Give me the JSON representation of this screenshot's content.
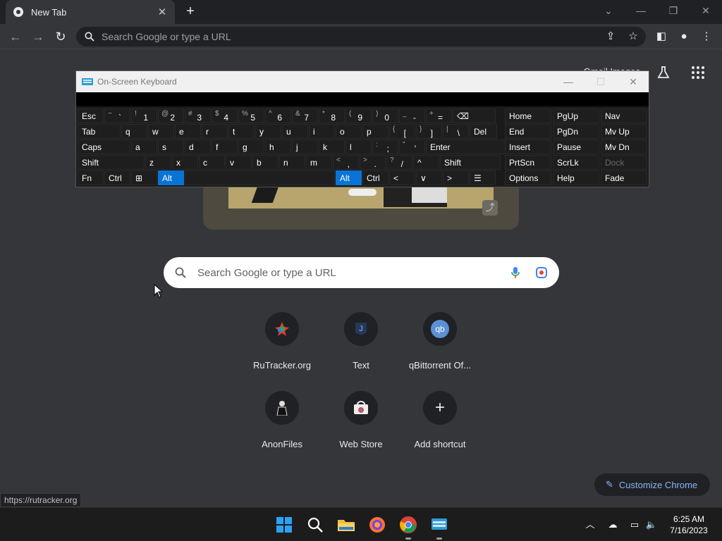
{
  "tab": {
    "title": "New Tab"
  },
  "omnibox": {
    "placeholder": "Search Google or type a URL"
  },
  "ntp": {
    "top_links": "Gmail   Images",
    "search_placeholder": "Search Google or type a URL",
    "shortcuts": [
      {
        "label": "RuTracker.org",
        "icon": "rutracker-icon"
      },
      {
        "label": "Text",
        "icon": "text-app-icon"
      },
      {
        "label": "qBittorrent Of...",
        "icon": "qbittorrent-icon"
      },
      {
        "label": "AnonFiles",
        "icon": "anonfiles-icon"
      },
      {
        "label": "Web Store",
        "icon": "web-store-icon"
      },
      {
        "label": "Add shortcut",
        "icon": "plus-icon"
      }
    ],
    "customize_label": "Customize Chrome"
  },
  "status_url": "https://rutracker.org",
  "osk": {
    "title": "On-Screen Keyboard",
    "rows": [
      [
        {
          "l": "Esc"
        },
        {
          "s": "~",
          "m": "`"
        },
        {
          "s": "!",
          "m": "1"
        },
        {
          "s": "@",
          "m": "2"
        },
        {
          "s": "#",
          "m": "3"
        },
        {
          "s": "$",
          "m": "4"
        },
        {
          "s": "%",
          "m": "5"
        },
        {
          "s": "^",
          "m": "6"
        },
        {
          "s": "&",
          "m": "7"
        },
        {
          "s": "*",
          "m": "8"
        },
        {
          "s": "(",
          "m": "9"
        },
        {
          "s": ")",
          "m": "0"
        },
        {
          "s": "_",
          "m": "-"
        },
        {
          "s": "+",
          "m": "="
        },
        {
          "l": "⌫"
        }
      ],
      [
        {
          "l": "Tab"
        },
        {
          "l": "q"
        },
        {
          "l": "w"
        },
        {
          "l": "e"
        },
        {
          "l": "r"
        },
        {
          "l": "t"
        },
        {
          "l": "y"
        },
        {
          "l": "u"
        },
        {
          "l": "i"
        },
        {
          "l": "o"
        },
        {
          "l": "p"
        },
        {
          "s": "{",
          "m": "["
        },
        {
          "s": "}",
          "m": "]"
        },
        {
          "s": "|",
          "m": "\\"
        },
        {
          "l": "Del"
        }
      ],
      [
        {
          "l": "Caps"
        },
        {
          "l": "a"
        },
        {
          "l": "s"
        },
        {
          "l": "d"
        },
        {
          "l": "f"
        },
        {
          "l": "g"
        },
        {
          "l": "h"
        },
        {
          "l": "j"
        },
        {
          "l": "k"
        },
        {
          "l": "l"
        },
        {
          "s": ":",
          "m": ";"
        },
        {
          "s": "\"",
          "m": "'"
        },
        {
          "l": "Enter"
        }
      ],
      [
        {
          "l": "Shift"
        },
        {
          "l": "z"
        },
        {
          "l": "x"
        },
        {
          "l": "c"
        },
        {
          "l": "v"
        },
        {
          "l": "b"
        },
        {
          "l": "n"
        },
        {
          "l": "m"
        },
        {
          "s": "<",
          "m": ","
        },
        {
          "s": ">",
          "m": "."
        },
        {
          "s": "?",
          "m": "/"
        },
        {
          "l": "^"
        },
        {
          "l": "Shift"
        }
      ],
      [
        {
          "l": "Fn"
        },
        {
          "l": "Ctrl"
        },
        {
          "l": "⊞"
        },
        {
          "l": "Alt",
          "on": true
        },
        {
          "l": ""
        },
        {
          "l": "Alt",
          "on": true
        },
        {
          "l": "Ctrl"
        },
        {
          "l": "<"
        },
        {
          "l": "∨"
        },
        {
          "l": ">"
        },
        {
          "l": "☰"
        }
      ]
    ],
    "nav_rows": [
      [
        {
          "l": "Home"
        },
        {
          "l": "PgUp"
        },
        {
          "l": "Nav"
        }
      ],
      [
        {
          "l": "End"
        },
        {
          "l": "PgDn"
        },
        {
          "l": "Mv Up"
        }
      ],
      [
        {
          "l": "Insert"
        },
        {
          "l": "Pause"
        },
        {
          "l": "Mv Dn"
        }
      ],
      [
        {
          "l": "PrtScn"
        },
        {
          "l": "ScrLk"
        },
        {
          "l": "Dock",
          "dim": true
        }
      ],
      [
        {
          "l": "Options"
        },
        {
          "l": "Help"
        },
        {
          "l": "Fade"
        }
      ]
    ]
  },
  "clock": {
    "time": "6:25 AM",
    "date": "7/16/2023"
  }
}
